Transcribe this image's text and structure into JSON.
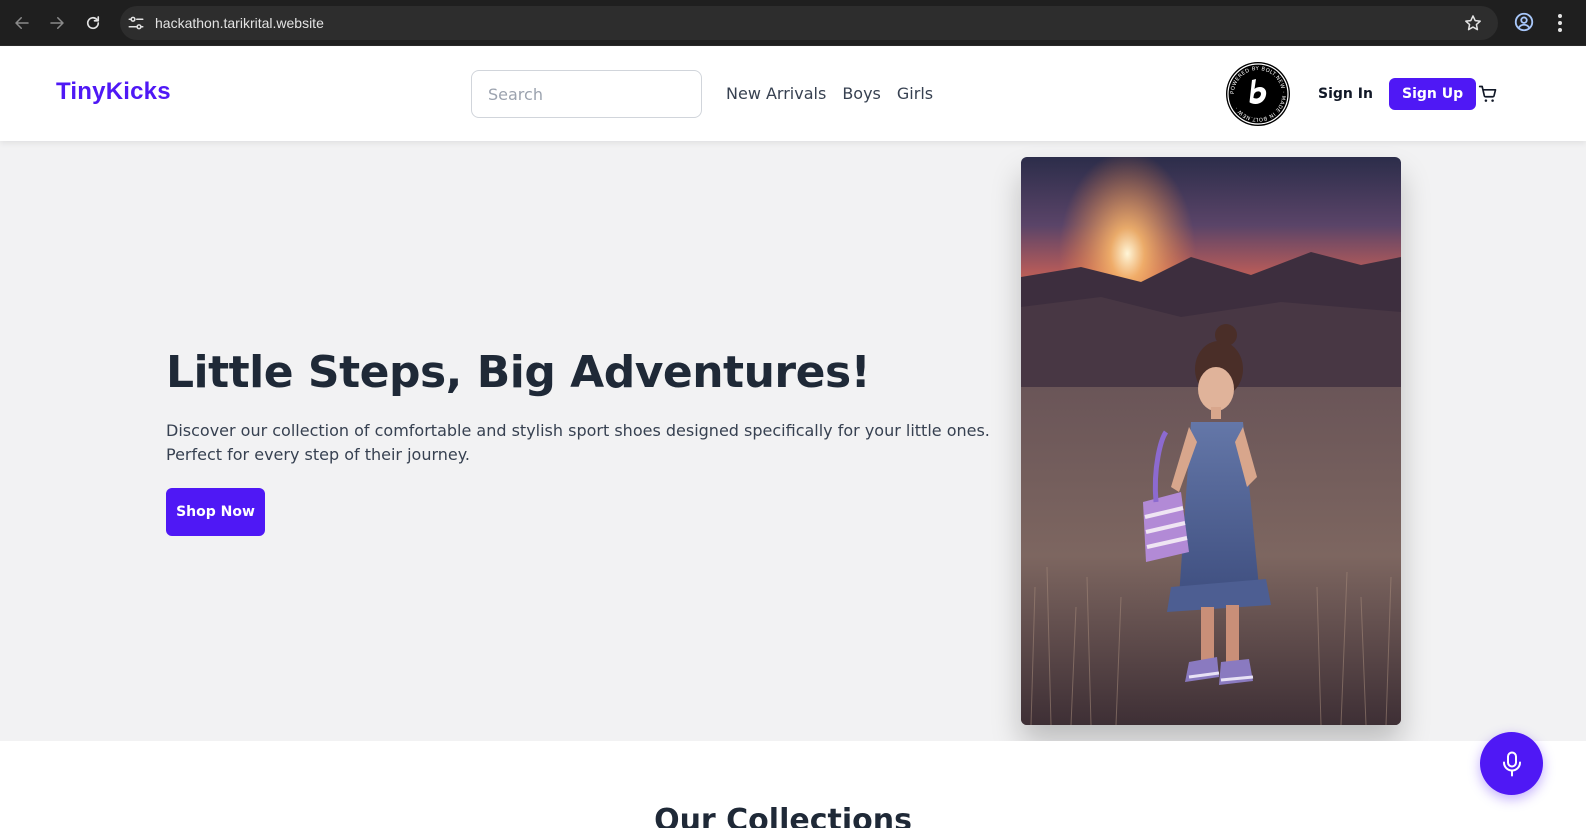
{
  "browser": {
    "url": "hackathon.tarikrital.website"
  },
  "header": {
    "logo": "TinyKicks",
    "search_placeholder": "Search",
    "nav": [
      "New Arrivals",
      "Boys",
      "Girls"
    ],
    "badge_text": "POWERED BY BOLT.NEW · MADE IN BOLT.NEW ·",
    "sign_in": "Sign In",
    "sign_up": "Sign Up"
  },
  "hero": {
    "title": "Little Steps, Big Adventures!",
    "description": "Discover our collection of comfortable and stylish sport shoes designed specifically for your little ones. Perfect for every step of their journey.",
    "cta": "Shop Now"
  },
  "collections": {
    "title": "Our Collections"
  },
  "colors": {
    "brand": "#4f18f5",
    "hero_bg": "#f2f2f3",
    "text_dark": "#1f2937"
  },
  "icons": {
    "back": "arrow-left-icon",
    "forward": "arrow-right-icon",
    "reload": "reload-icon",
    "site_info": "tune-icon",
    "bookmark": "star-icon",
    "profile": "profile-icon",
    "menu": "kebab-icon",
    "cart": "cart-icon",
    "voice": "microphone-icon"
  }
}
